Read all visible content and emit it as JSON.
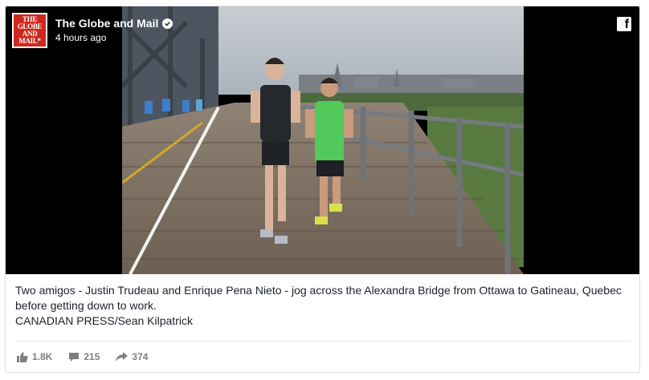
{
  "post": {
    "page_name": "The Globe and Mail",
    "timestamp": "4 hours ago",
    "logo_lines": [
      "THE",
      "GLOBE",
      "AND",
      "MAIL*"
    ],
    "caption": "Two amigos - Justin Trudeau and Enrique Pena Nieto - jog across the Alexandra Bridge from Ottawa to Gatineau, Quebec before getting down to work.",
    "credit": "CANADIAN PRESS/Sean Kilpatrick"
  },
  "stats": {
    "likes": "1.8K",
    "comments": "215",
    "shares": "374"
  },
  "icons": {
    "brand": "facebook-icon",
    "verified": "verified-check-icon",
    "like": "thumbs-up-icon",
    "comment": "comment-bubble-icon",
    "share": "share-arrow-icon"
  },
  "colors": {
    "logo_red": "#d0271d",
    "stat_gray": "#7f7f7f",
    "caption_text": "#1d2129"
  }
}
